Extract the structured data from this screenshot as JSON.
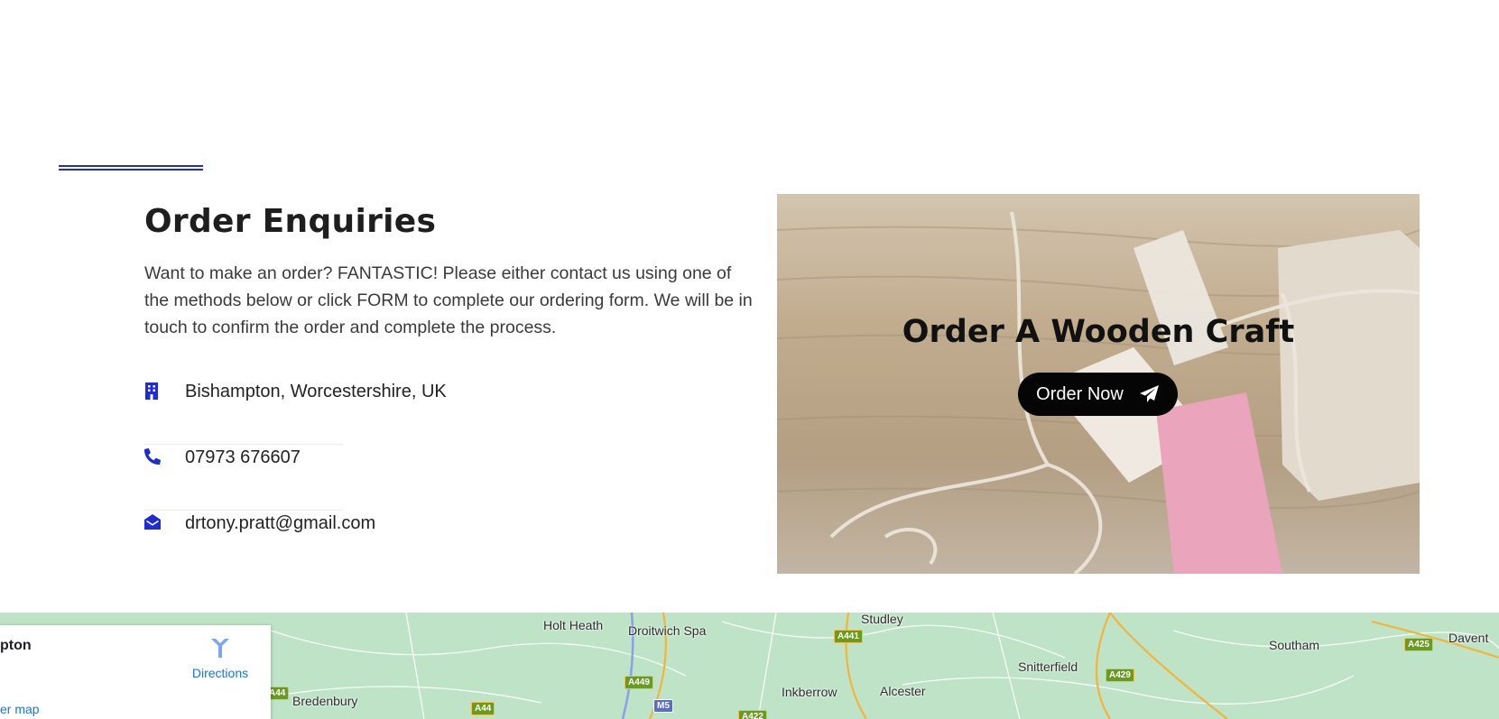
{
  "section": {
    "title": "Order Enquiries",
    "description": "Want to make an order? FANTASTIC! Please either contact us using one of the methods below or click FORM to complete our ordering form. We will be in touch to confirm the order and complete the process."
  },
  "contacts": [
    {
      "icon": "building-icon",
      "text": "Bishampton, Worcestershire, UK"
    },
    {
      "icon": "phone-icon",
      "text": "07973 676607"
    },
    {
      "icon": "envelope-open-icon",
      "text": "drtony.pratt@gmail.com"
    }
  ],
  "promo": {
    "title": "Order A Wooden Craft",
    "button_label": "Order Now",
    "button_icon": "paper-plane-icon"
  },
  "map": {
    "place_name": "pton",
    "directions_label": "Directions",
    "larger_map_link": "er map",
    "labels": [
      "Holt Heath",
      "Droitwich Spa",
      "Studley",
      "Snitterfield",
      "Southam",
      "Davent",
      "Inkberrow",
      "Alcester",
      "Bredenbury"
    ],
    "roads": [
      "A441",
      "A449",
      "A44",
      "M5",
      "A422",
      "A429",
      "A425",
      "A44"
    ]
  },
  "colors": {
    "accent": "#1f2bd4",
    "button": "#050505",
    "map_land": "#bfe3c7",
    "link": "#1a73e8"
  }
}
